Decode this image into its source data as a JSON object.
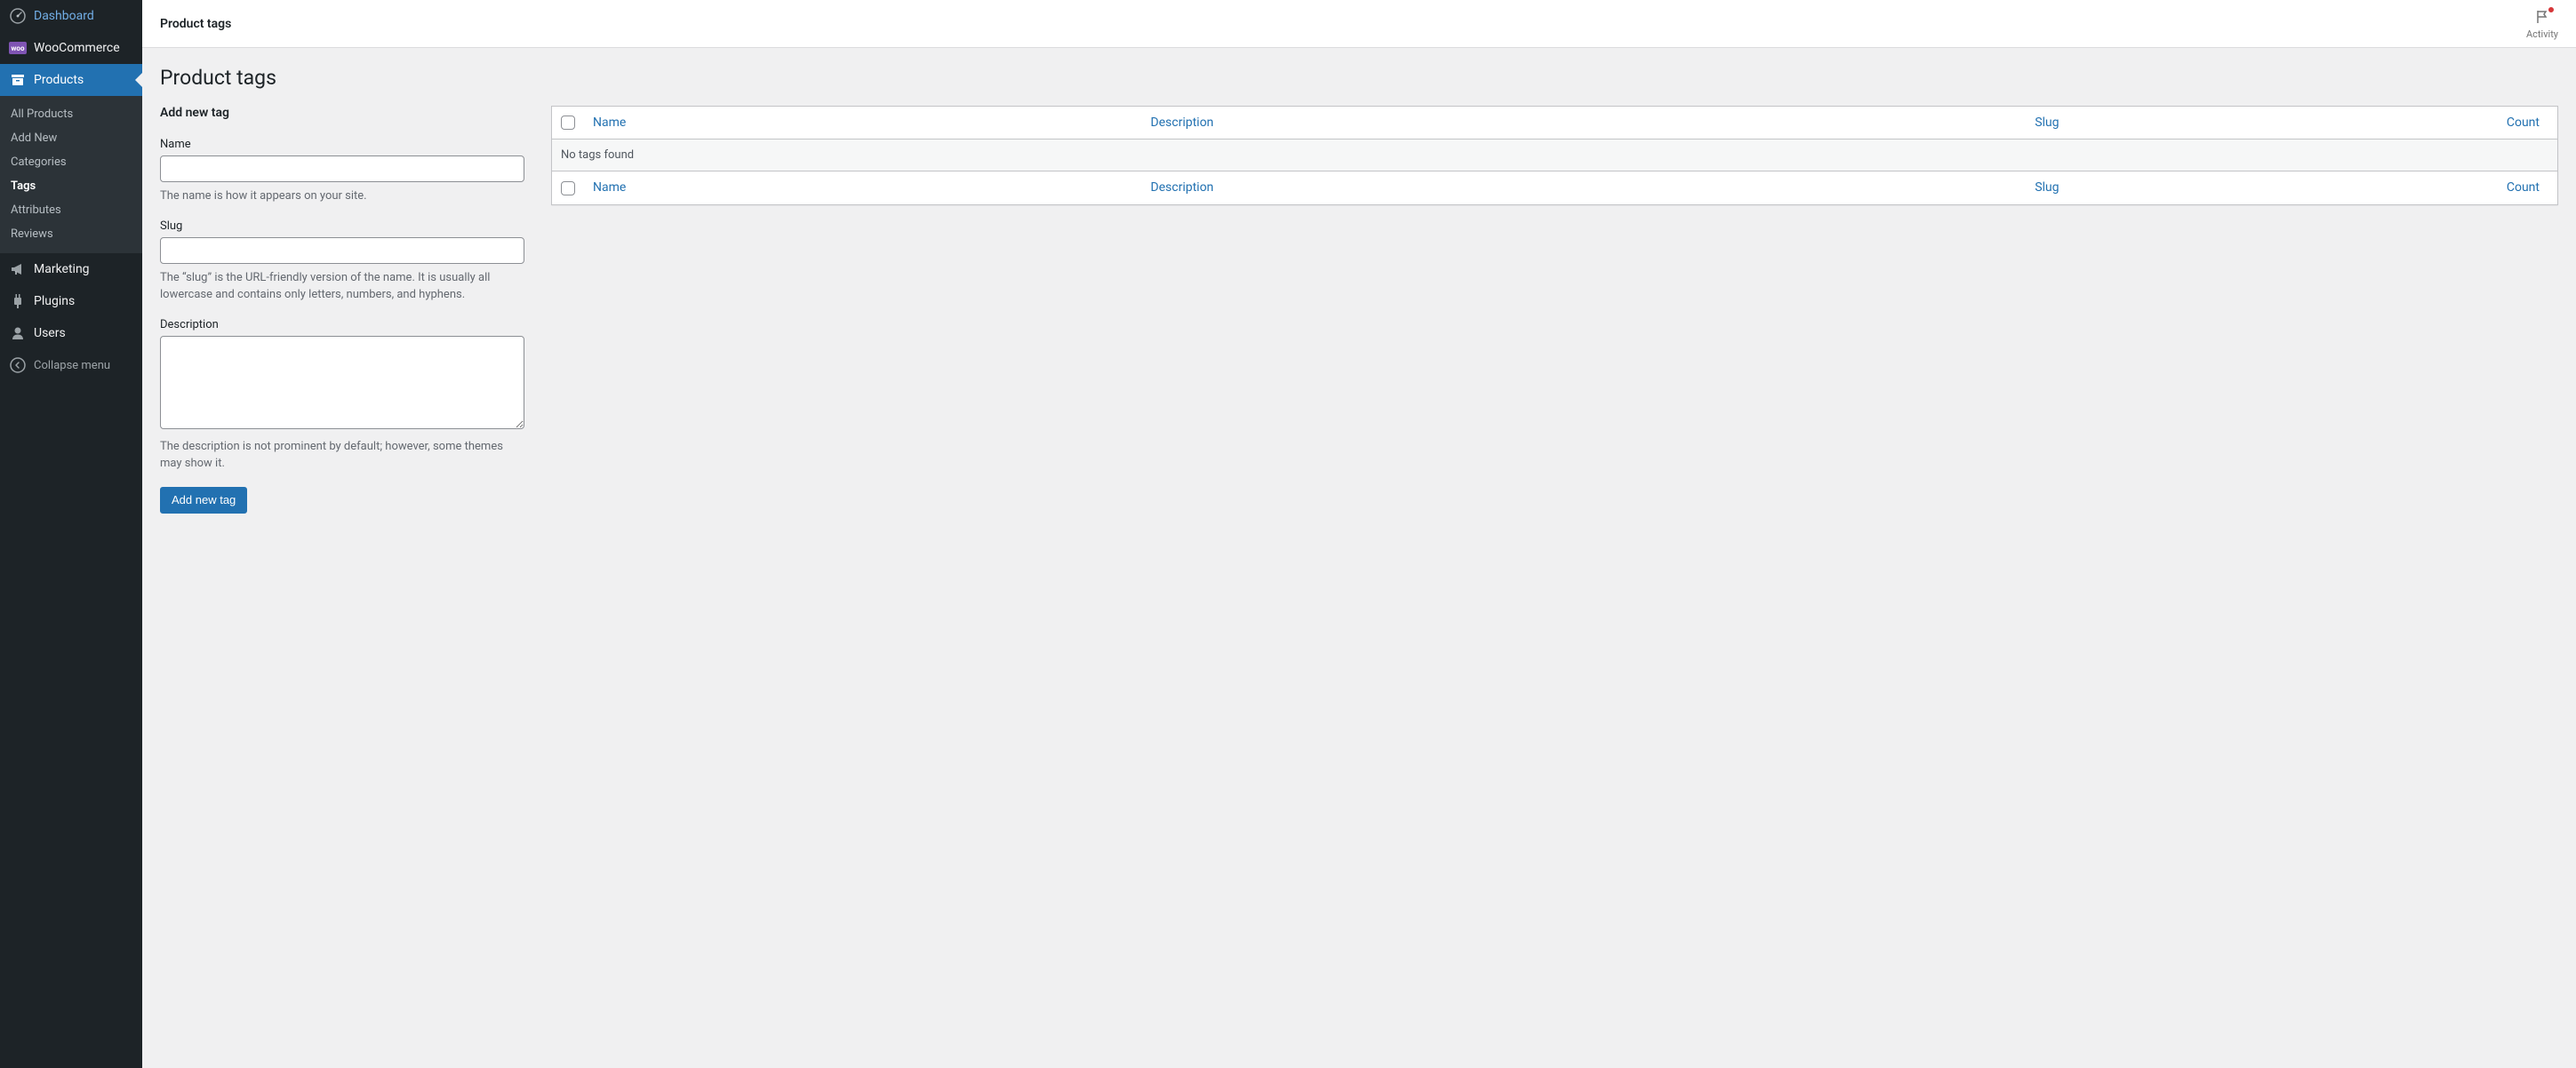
{
  "sidebar": {
    "dashboard": "Dashboard",
    "woocommerce": "WooCommerce",
    "products": "Products",
    "marketing": "Marketing",
    "plugins": "Plugins",
    "users": "Users",
    "collapse": "Collapse menu",
    "submenu": {
      "all_products": "All Products",
      "add_new": "Add New",
      "categories": "Categories",
      "tags": "Tags",
      "attributes": "Attributes",
      "reviews": "Reviews"
    }
  },
  "topbar": {
    "title": "Product tags",
    "activity": "Activity"
  },
  "page": {
    "title": "Product tags"
  },
  "form": {
    "heading": "Add new tag",
    "name_label": "Name",
    "name_help": "The name is how it appears on your site.",
    "slug_label": "Slug",
    "slug_help": "The “slug” is the URL-friendly version of the name. It is usually all lowercase and contains only letters, numbers, and hyphens.",
    "description_label": "Description",
    "description_help": "The description is not prominent by default; however, some themes may show it.",
    "submit": "Add new tag"
  },
  "table": {
    "columns": {
      "name": "Name",
      "description": "Description",
      "slug": "Slug",
      "count": "Count"
    },
    "empty": "No tags found"
  },
  "woo_badge": "woo"
}
